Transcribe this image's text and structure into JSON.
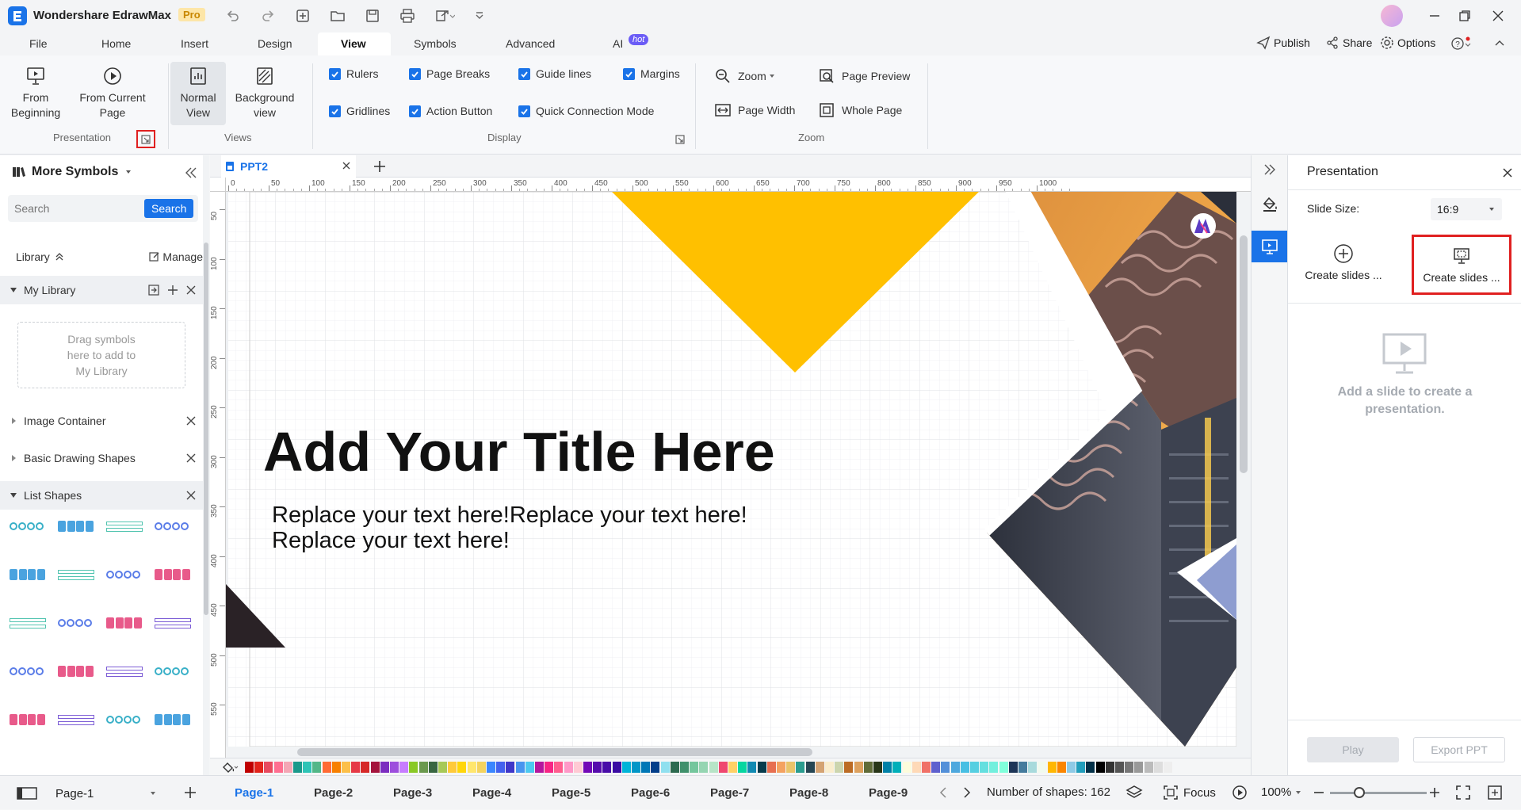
{
  "app": {
    "title": "Wondershare EdrawMax",
    "badge": "Pro"
  },
  "menu": {
    "items": [
      "File",
      "Home",
      "Insert",
      "Design",
      "View",
      "Symbols",
      "Advanced",
      "AI"
    ],
    "active": "View",
    "ai_badge": "hot",
    "right": {
      "publish": "Publish",
      "share": "Share",
      "options": "Options"
    }
  },
  "ribbon": {
    "presentation": {
      "from_beginning": "From\nBeginning",
      "from_current": "From Current\nPage",
      "label": "Presentation"
    },
    "views": {
      "normal": "Normal\nView",
      "background": "Background\nview",
      "label": "Views"
    },
    "display": {
      "items": [
        "Rulers",
        "Page Breaks",
        "Guide lines",
        "Margins",
        "Gridlines",
        "Action Button",
        "Quick Connection Mode"
      ],
      "label": "Display"
    },
    "zoom": {
      "zoom": "Zoom",
      "page_preview": "Page Preview",
      "page_width": "Page Width",
      "whole_page": "Whole Page",
      "label": "Zoom"
    }
  },
  "left": {
    "title": "More Symbols",
    "search_placeholder": "Search",
    "search_button": "Search",
    "library": "Library",
    "manage": "Manage",
    "my_library": "My Library",
    "drag_hint": "Drag symbols\nhere to add to\nMy Library",
    "sections": [
      "Image Container",
      "Basic Drawing Shapes",
      "List Shapes"
    ]
  },
  "doc": {
    "tab": "PPT2"
  },
  "ruler": {
    "h": [
      "0",
      "50",
      "100",
      "150",
      "200",
      "250",
      "300",
      "350",
      "400",
      "450",
      "500",
      "550",
      "600",
      "650",
      "700",
      "750",
      "800",
      "850",
      "900",
      "950",
      "1000"
    ],
    "v": [
      "50",
      "100",
      "150",
      "200",
      "250",
      "300",
      "350",
      "400",
      "450",
      "500",
      "550"
    ]
  },
  "slide": {
    "title": "Add Your Title Here",
    "body_line1": "Replace your text here!Replace your text here!",
    "body_line2": "Replace your text here!"
  },
  "right": {
    "title": "Presentation",
    "slide_size_label": "Slide Size:",
    "slide_size_value": "16:9",
    "create1": "Create slides ...",
    "create2": "Create slides ...",
    "empty_text": "Add a slide to create a\npresentation.",
    "play": "Play",
    "export": "Export PPT"
  },
  "status": {
    "page_select": "Page-1",
    "pages": [
      "Page-1",
      "Page-2",
      "Page-3",
      "Page-4",
      "Page-5",
      "Page-6",
      "Page-7",
      "Page-8",
      "Page-9"
    ],
    "shapes": "Number of shapes: 162",
    "focus": "Focus",
    "zoom": "100%",
    "zoom_level": 0.3
  },
  "colors": {
    "accent": "#1a73e8",
    "yellow": "#ffc000",
    "highlight": "#e02020",
    "palette": [
      "#c00000",
      "#e2231a",
      "#e84a5f",
      "#ff6f91",
      "#f4a6b5",
      "#1b998b",
      "#2ec4b6",
      "#52b788",
      "#ff6b35",
      "#f77f00",
      "#fcbf49",
      "#e63946",
      "#d62828",
      "#a4133c",
      "#7b2cbf",
      "#9d4edd",
      "#c77dff",
      "#8ac926",
      "#6a994e",
      "#386641",
      "#a7c957",
      "#ffca3a",
      "#ffd60a",
      "#ffe66d",
      "#f4d35e",
      "#3a86ff",
      "#4361ee",
      "#3f37c9",
      "#4895ef",
      "#4cc9f0",
      "#b5179e",
      "#f72585",
      "#ff5d8f",
      "#ff99c8",
      "#ffcad4",
      "#7209b7",
      "#560bad",
      "#480ca8",
      "#3a0ca3",
      "#00b4d8",
      "#0096c7",
      "#0077b6",
      "#023e8a",
      "#90e0ef",
      "#2d6a4f",
      "#40916c",
      "#74c69d",
      "#95d5b2",
      "#b7e4c7",
      "#ef476f",
      "#ffd166",
      "#06d6a0",
      "#118ab2",
      "#073b4c",
      "#e76f51",
      "#f4a261",
      "#e9c46a",
      "#2a9d8f",
      "#264653",
      "#d4a373",
      "#faedcd",
      "#ccd5ae",
      "#bc6c25",
      "#dda15e",
      "#606c38",
      "#283618",
      "#0081a7",
      "#00afb9",
      "#fdfcdc",
      "#fed9b7",
      "#f07167",
      "#5e60ce",
      "#5390d9",
      "#4ea8de",
      "#48bfe3",
      "#56cfe1",
      "#64dfdf",
      "#72efdd",
      "#80ffdb",
      "#1d3557",
      "#457b9d",
      "#a8dadc",
      "#f1faee",
      "#ffb703",
      "#fb8500",
      "#8ecae6",
      "#219ebc",
      "#023047",
      "#000000",
      "#333333",
      "#555555",
      "#777777",
      "#999999",
      "#bbbbbb",
      "#dddddd",
      "#eeeeee"
    ]
  }
}
